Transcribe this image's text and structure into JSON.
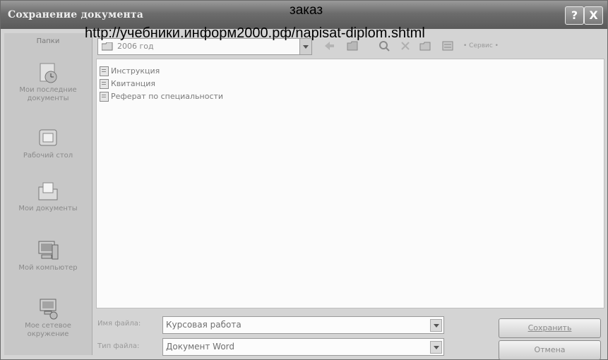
{
  "title": "Сохранение документа",
  "overlay": {
    "line1": "заказ",
    "line2": "http://учебники.информ2000.рф/napisat-diplom.shtml"
  },
  "titlebar": {
    "help_label": "?",
    "close_label": "X"
  },
  "places": {
    "header": "Папки",
    "items": [
      {
        "label": "Мои последние документы",
        "icon": "recent-documents-icon"
      },
      {
        "label": "Рабочий стол",
        "icon": "desktop-icon"
      },
      {
        "label": "Мои документы",
        "icon": "my-documents-icon"
      },
      {
        "label": "Мой компьютер",
        "icon": "my-computer-icon"
      },
      {
        "label": "Мое сетевое окружение",
        "icon": "network-places-icon"
      }
    ]
  },
  "toolbar": {
    "folder": "2006 год",
    "tools_label": "• Сервис •"
  },
  "files": [
    {
      "name": "Инструкция"
    },
    {
      "name": "Квитанция"
    },
    {
      "name": "Реферат по специальности"
    }
  ],
  "filename": {
    "label": "Имя файла:",
    "value": "Курсовая работа"
  },
  "filetype": {
    "label": "Тип файла:",
    "value": "Документ Word"
  },
  "buttons": {
    "save": "Сохранить",
    "cancel": "Отмена"
  }
}
